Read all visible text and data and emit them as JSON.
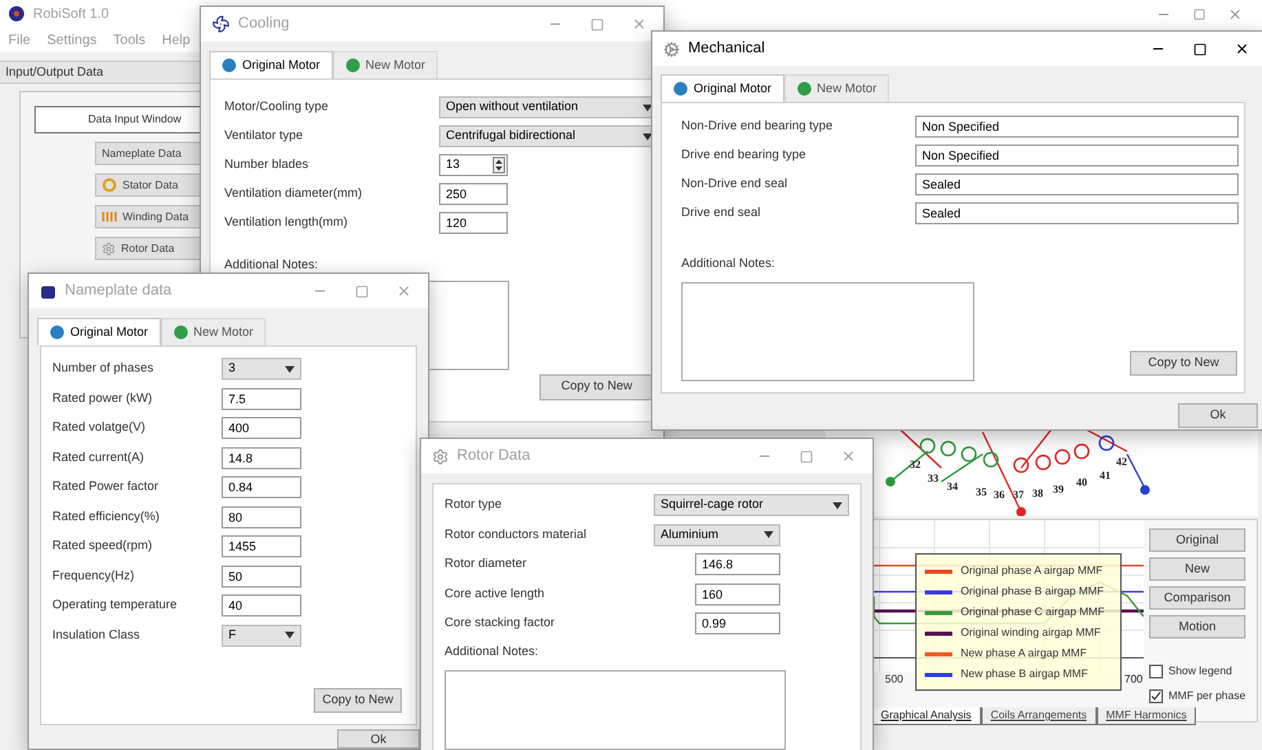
{
  "main_window": {
    "title": "RobiSoft 1.0",
    "menu": [
      "File",
      "Settings",
      "Tools",
      "Help"
    ],
    "panel_title": "Input/Output Data",
    "data_input": {
      "title": "Data Input Window",
      "buttons": [
        {
          "label": "Nameplate Data",
          "kind": "plain"
        },
        {
          "label": "Stator Data",
          "kind": "stator"
        },
        {
          "label": "Winding Data",
          "kind": "winding"
        },
        {
          "label": "Rotor Data",
          "kind": "rotor"
        }
      ]
    },
    "winding_labels": [
      "32",
      "33",
      "34",
      "35",
      "36",
      "37",
      "38",
      "39",
      "40",
      "41",
      "42"
    ],
    "analysis": {
      "buttons": [
        "Original",
        "New",
        "Comparison",
        "Motion"
      ],
      "options": [
        {
          "label": "Show legend",
          "checked": false
        },
        {
          "label": "MMF per phase",
          "checked": true
        }
      ],
      "legend": [
        {
          "label": "Original phase A airgap MMF",
          "color": "#e8472a"
        },
        {
          "label": "Original phase B airgap MMF",
          "color": "#3a3ae0"
        },
        {
          "label": "Original phase C airgap MMF",
          "color": "#3c9a3c"
        },
        {
          "label": "Original winding airgap MMF",
          "color": "#5a1050"
        },
        {
          "label": "New phase A airgap MMF",
          "color": "#f05a20"
        },
        {
          "label": "New phase B airgap MMF",
          "color": "#3040e8"
        }
      ],
      "axis_labels": [
        "500",
        "700"
      ],
      "tabs": [
        {
          "label": "Graphical Analysis",
          "selected": true
        },
        {
          "label": "Coils Arrangements",
          "selected": false
        },
        {
          "label": "MMF Harmonics",
          "selected": false
        }
      ]
    }
  },
  "cooling": {
    "title": "Cooling",
    "active": false,
    "tabs": [
      {
        "label": "Original Motor",
        "selected": true,
        "color": "#2a7fc0"
      },
      {
        "label": "New Motor",
        "selected": false,
        "color": "#2e9e4a"
      }
    ],
    "rows": [
      {
        "label": "Motor/Cooling type",
        "kind": "dropdown",
        "value": "Open without ventilation"
      },
      {
        "label": "Ventilator type",
        "kind": "dropdown",
        "value": "Centrifugal bidirectional"
      },
      {
        "label": "Number blades",
        "kind": "spin",
        "value": "13"
      },
      {
        "label": "Ventilation diameter(mm)",
        "kind": "text",
        "value": "250"
      },
      {
        "label": "Ventilation length(mm)",
        "kind": "text",
        "value": "120"
      }
    ],
    "notes_label": "Additional Notes:",
    "copy_button": "Copy to New"
  },
  "mechanical": {
    "title": "Mechanical",
    "active": true,
    "tabs": [
      {
        "label": "Original Motor",
        "selected": true,
        "color": "#2a7fc0"
      },
      {
        "label": "New Motor",
        "selected": false,
        "color": "#2e9e4a"
      }
    ],
    "rows": [
      {
        "label": "Non-Drive end bearing type",
        "kind": "text",
        "value": "Non Specified"
      },
      {
        "label": "Drive end bearing type",
        "kind": "text",
        "value": "Non Specified"
      },
      {
        "label": "Non-Drive end seal",
        "kind": "text",
        "value": "Sealed"
      },
      {
        "label": "Drive end seal",
        "kind": "text",
        "value": "Sealed"
      }
    ],
    "notes_label": "Additional Notes:",
    "copy_button": "Copy to New",
    "ok_button": "Ok"
  },
  "nameplate": {
    "title": "Nameplate data",
    "active": false,
    "tabs": [
      {
        "label": "Original Motor",
        "selected": true,
        "color": "#2a7fc0"
      },
      {
        "label": "New Motor",
        "selected": false,
        "color": "#2e9e4a"
      }
    ],
    "rows": [
      {
        "label": "Number of phases",
        "kind": "dropdown",
        "value": "3"
      },
      {
        "label": "Rated power (kW)",
        "kind": "text",
        "value": "7.5"
      },
      {
        "label": "Rated volatge(V)",
        "kind": "text",
        "value": "400"
      },
      {
        "label": "Rated current(A)",
        "kind": "text",
        "value": "14.8"
      },
      {
        "label": "Rated Power factor",
        "kind": "text",
        "value": "0.84"
      },
      {
        "label": "Rated efficiency(%)",
        "kind": "text",
        "value": "80"
      },
      {
        "label": "Rated speed(rpm)",
        "kind": "text",
        "value": "1455"
      },
      {
        "label": "Frequency(Hz)",
        "kind": "text",
        "value": "50"
      },
      {
        "label": "Operating temperature",
        "kind": "text",
        "value": "40"
      },
      {
        "label": "Insulation Class",
        "kind": "dropdown",
        "value": "F"
      }
    ],
    "copy_button": "Copy to New",
    "ok_button": "Ok"
  },
  "rotor": {
    "title": "Rotor Data",
    "active": false,
    "rows": [
      {
        "label": "Rotor type",
        "kind": "dropdown",
        "value": "Squirrel-cage rotor"
      },
      {
        "label": "Rotor conductors material",
        "kind": "dropdown",
        "value": "Aluminium"
      },
      {
        "label": "Rotor diameter",
        "kind": "text",
        "value": "146.8"
      },
      {
        "label": "Core active length",
        "kind": "text",
        "value": "160"
      },
      {
        "label": "Core stacking factor",
        "kind": "text",
        "value": "0.99"
      }
    ],
    "notes_label": "Additional Notes:"
  }
}
